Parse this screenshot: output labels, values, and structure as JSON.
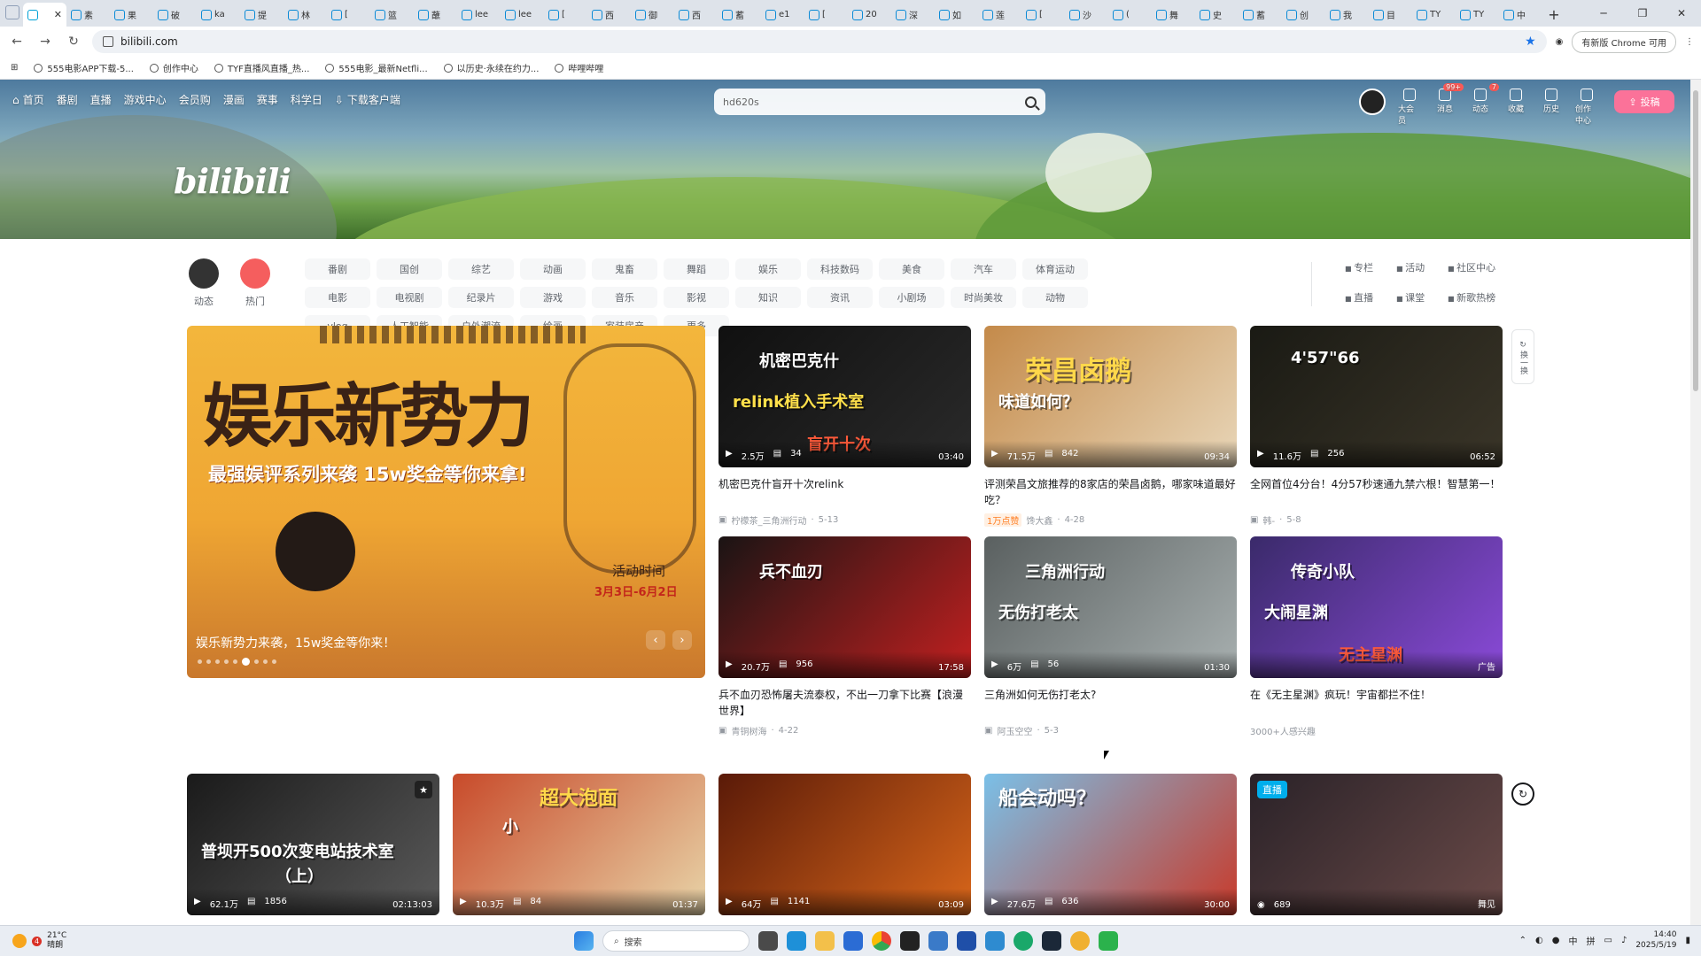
{
  "browser": {
    "tabs": [
      {
        "title": "",
        "active": true
      },
      {
        "title": "素",
        "active": false
      },
      {
        "title": "果",
        "active": false
      },
      {
        "title": "破",
        "active": false
      },
      {
        "title": "ka",
        "active": false
      },
      {
        "title": "提",
        "active": false
      },
      {
        "title": "林",
        "active": false
      },
      {
        "title": "[",
        "active": false
      },
      {
        "title": "篮",
        "active": false
      },
      {
        "title": "蘸",
        "active": false
      },
      {
        "title": "lee",
        "active": false
      },
      {
        "title": "lee",
        "active": false
      },
      {
        "title": "[",
        "active": false
      },
      {
        "title": "西",
        "active": false
      },
      {
        "title": "御",
        "active": false
      },
      {
        "title": "西",
        "active": false
      },
      {
        "title": "蓄",
        "active": false
      },
      {
        "title": "e1",
        "active": false
      },
      {
        "title": "[",
        "active": false
      },
      {
        "title": "20",
        "active": false
      },
      {
        "title": "深",
        "active": false
      },
      {
        "title": "如",
        "active": false
      },
      {
        "title": "莲",
        "active": false
      },
      {
        "title": "[",
        "active": false
      },
      {
        "title": "沙",
        "active": false
      },
      {
        "title": "(",
        "active": false
      },
      {
        "title": "舞",
        "active": false
      },
      {
        "title": "史",
        "active": false
      },
      {
        "title": "蓄",
        "active": false
      },
      {
        "title": "创",
        "active": false
      },
      {
        "title": "我",
        "active": false
      },
      {
        "title": "目",
        "active": false
      },
      {
        "title": "TY",
        "active": false
      },
      {
        "title": "TY",
        "active": false
      },
      {
        "title": "中",
        "active": false
      }
    ],
    "new_tab_label": "+",
    "url": "bilibili.com",
    "update_chip": "有新版 Chrome 可用",
    "bookmarks": [
      "555电影APP下载-5...",
      "创作中心",
      "TYF直播风直播_热...",
      "555电影_最新Netfli...",
      "以历史·永续在约力...",
      "哔哩哔哩"
    ]
  },
  "header": {
    "nav": [
      "首页",
      "番剧",
      "直播",
      "游戏中心",
      "会员购",
      "漫画",
      "赛事",
      "科学日",
      "下载客户端"
    ],
    "search_placeholder": "hd620s",
    "tools": [
      {
        "label": "大会员",
        "icon": "vip-icon",
        "badge": ""
      },
      {
        "label": "消息",
        "icon": "message-icon",
        "badge": "99+"
      },
      {
        "label": "动态",
        "icon": "dynamic-icon",
        "badge": "7"
      },
      {
        "label": "收藏",
        "icon": "favorite-icon",
        "badge": ""
      },
      {
        "label": "历史",
        "icon": "history-icon",
        "badge": ""
      },
      {
        "label": "创作中心",
        "icon": "creator-icon",
        "badge": ""
      }
    ],
    "upload_label": "投稿",
    "logo_text": "bilibili"
  },
  "channels": {
    "left_icons": [
      {
        "label": "动态",
        "color": "#333333"
      },
      {
        "label": "热门",
        "color": "#f55e5e"
      }
    ],
    "buttons": [
      "番剧",
      "国创",
      "综艺",
      "动画",
      "鬼畜",
      "舞蹈",
      "娱乐",
      "科技数码",
      "美食",
      "汽车",
      "体育运动",
      "电影",
      "电视剧",
      "纪录片",
      "游戏",
      "音乐",
      "影视",
      "知识",
      "资讯",
      "小剧场",
      "时尚美妆",
      "动物",
      "vlog",
      "人工智能",
      "户外潮流",
      "绘画",
      "家装房产",
      "更多"
    ],
    "extras": [
      "专栏",
      "活动",
      "社区中心",
      "直播",
      "课堂",
      "新歌热榜"
    ]
  },
  "carousel": {
    "headline": "娱乐新势力",
    "subline": "最强娱评系列来袭 15w奖金等你来拿!",
    "event_label": "活动时间",
    "event_date": "3月3日-6月2日",
    "caption": "娱乐新势力来袭，15w奖金等你来！",
    "dot_count": 9,
    "active_dot": 5,
    "prev": "‹",
    "next": "›"
  },
  "refresh_label": "换一换",
  "videos": [
    {
      "thumb_text": "机密巴克什",
      "thumb_text2": "relink植入手术室",
      "thumb_text3": "盲开十次",
      "views": "2.5万",
      "danmaku": "34",
      "duration": "03:40",
      "title": "机密巴克什盲开十次relink",
      "author": "柠檬茶_三角洲行动",
      "date": "5-13",
      "hot": "",
      "color1": "#101010",
      "color2": "#2a2a2a"
    },
    {
      "thumb_text": "荣昌卤鹅",
      "thumb_text2": "味道如何？",
      "thumb_text3": "",
      "views": "71.5万",
      "danmaku": "842",
      "duration": "09:34",
      "title": "评测荣昌文旅推荐的8家店的荣昌卤鹅，哪家味道最好吃？",
      "author": "馋大鑫",
      "date": "4-28",
      "hot": "1万点赞",
      "color1": "#c48a4a",
      "color2": "#e8d6b8"
    },
    {
      "thumb_text": "4'57\"66",
      "thumb_text2": "",
      "thumb_text3": "",
      "views": "11.6万",
      "danmaku": "256",
      "duration": "06:52",
      "title": "全网首位4分台！4分57秒速通九禁六根！智慧第一！",
      "author": "韩-",
      "date": "5-8",
      "hot": "",
      "color1": "#1a1a14",
      "color2": "#3a3528"
    },
    {
      "thumb_text": "兵不血刃",
      "thumb_text2": "",
      "thumb_text3": "",
      "views": "20.7万",
      "danmaku": "956",
      "duration": "17:58",
      "title": "兵不血刃恐怖屠夫流泰权，不出一刀拿下比赛【浪漫世界】",
      "author": "青铜树海",
      "date": "4-22",
      "hot": "",
      "color1": "#1a1414",
      "color2": "#c22020"
    },
    {
      "thumb_text": "三角洲行动",
      "thumb_text2": "无伤打老太",
      "thumb_text3": "",
      "views": "6万",
      "danmaku": "56",
      "duration": "01:30",
      "title": "三角洲如何无伤打老太?",
      "author": "阿玉空空",
      "date": "5-3",
      "hot": "",
      "color1": "#5a6060",
      "color2": "#a8b0b0"
    },
    {
      "thumb_text": "传奇小队",
      "thumb_text2": "大闹星渊",
      "thumb_text3": "无主星渊",
      "views": "",
      "danmaku": "",
      "duration": "广告",
      "title": "在《无主星渊》疯玩！宇宙都拦不住！",
      "author": "3000+人感兴趣",
      "date": "",
      "hot": "",
      "color1": "#3a2a6a",
      "color2": "#8a4ad8"
    }
  ],
  "bottom_videos": [
    {
      "thumb_text": "普坝开500次变电站技术室",
      "thumb_text2": "（上）",
      "views": "62.1万",
      "danmaku": "1856",
      "duration": "02:13:03",
      "badge": "★",
      "color1": "#1a1a1a",
      "color2": "#5a5a5a"
    },
    {
      "thumb_text": "超大泡面",
      "thumb_text2": "小",
      "views": "10.3万",
      "danmaku": "84",
      "duration": "01:37",
      "badge": "",
      "color1": "#c84a2a",
      "color2": "#e8d4a8"
    },
    {
      "thumb_text": "",
      "thumb_text2": "",
      "views": "64万",
      "danmaku": "1141",
      "duration": "03:09",
      "badge": "",
      "color1": "#5a1a08",
      "color2": "#d8661a"
    },
    {
      "thumb_text": "船会动吗？",
      "thumb_text2": "",
      "views": "27.6万",
      "danmaku": "636",
      "duration": "30:00",
      "badge": "",
      "color1": "#7ac0e8",
      "color2": "#c83a2a"
    },
    {
      "thumb_text": "",
      "thumb_text2": "",
      "views": "689",
      "danmaku": "",
      "duration": "舞见",
      "badge": "直播",
      "color1": "#2a2228",
      "color2": "#6a4a48"
    }
  ],
  "taskbar": {
    "weather_temp": "21°C",
    "weather_desc": "晴朗",
    "weather_badge": "4",
    "search_label": "搜索",
    "ime": "中",
    "ime2": "拼",
    "time": "14:40",
    "date": "2025/5/19"
  }
}
